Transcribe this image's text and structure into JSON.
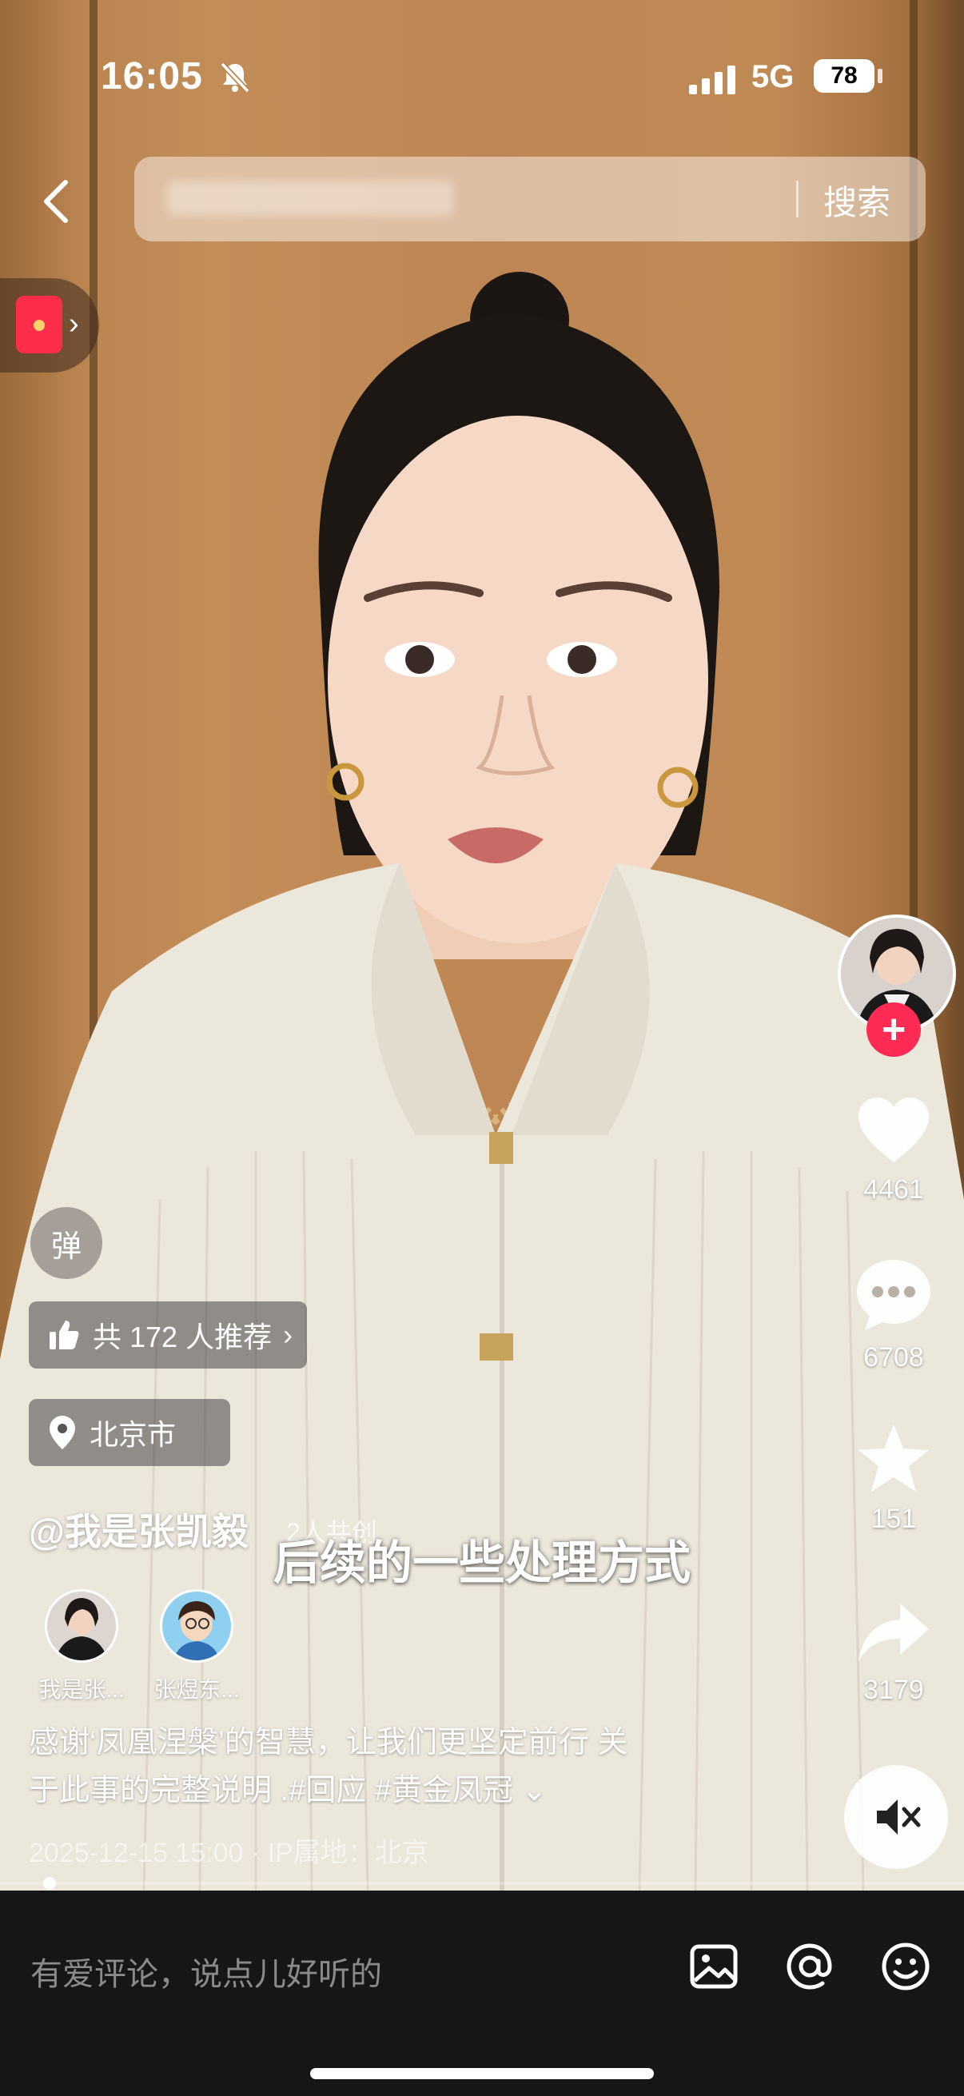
{
  "status_bar": {
    "time": "16:05",
    "network": "5G",
    "battery": "78"
  },
  "top_bar": {
    "search_button": "搜索"
  },
  "right_actions": {
    "likes": "4461",
    "comments": "6708",
    "favorites": "151",
    "shares": "3179"
  },
  "overlay": {
    "danmu_label": "弹",
    "recommend_label": "共 172 人推荐",
    "location_label": "北京市",
    "author": "@我是张凯毅",
    "cocreate": "2人共创",
    "subtitle": "后续的一些处理方式",
    "creators": [
      {
        "name": "我是张..."
      },
      {
        "name": "张煜东..."
      }
    ],
    "description_line1": "感谢‘凤凰涅槃’的智慧，让我们更坚定前行 关",
    "description_line2": "于此事的完整说明 .#回应 #黄金凤冠",
    "post_meta": "2025-12-15 15:00 · IP属地：北京"
  },
  "comment_bar": {
    "placeholder": "有爱评论，说点儿好听的"
  },
  "colors": {
    "accent_red": "#ff2b55",
    "bottom_bar": "#161616",
    "wall": "#bd8654"
  },
  "icons": [
    "bell-off-icon",
    "signal-icon",
    "back-icon",
    "red-packet-icon",
    "heart-icon",
    "comment-icon",
    "star-icon",
    "share-icon",
    "mute-icon",
    "thumb-up-icon",
    "location-pin-icon",
    "image-icon",
    "at-icon",
    "emoji-icon"
  ]
}
